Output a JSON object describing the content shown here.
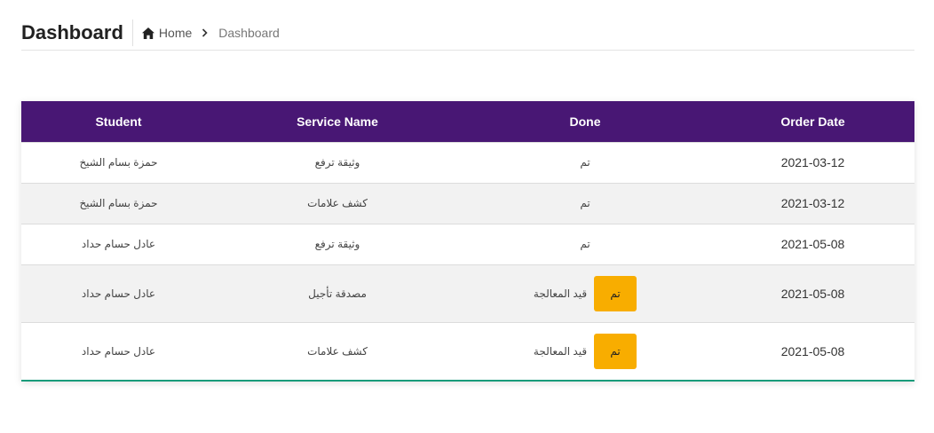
{
  "header": {
    "title": "Dashboard",
    "breadcrumb": {
      "home": "Home",
      "current": "Dashboard"
    }
  },
  "table": {
    "columns": [
      "Student",
      "Service Name",
      "Done",
      "Order Date"
    ],
    "rows": [
      {
        "student": "حمزة بسام الشيخ",
        "service": "وثيقة ترفع",
        "done": "تم",
        "date": "2021-03-12"
      },
      {
        "student": "حمزة بسام الشيخ",
        "service": "كشف علامات",
        "done": "تم",
        "date": "2021-03-12"
      },
      {
        "student": "عادل حسام حداد",
        "service": "وثيقة ترفع",
        "done": "تم",
        "date": "2021-05-08"
      },
      {
        "student": "عادل حسام حداد",
        "service": "مصدقة تأجيل",
        "done": "قيد المعالجة",
        "button": "تم",
        "date": "2021-05-08"
      },
      {
        "student": "عادل حسام حداد",
        "service": "كشف علامات",
        "done": "قيد المعالجة",
        "button": "تم",
        "date": "2021-05-08"
      }
    ]
  },
  "colors": {
    "header_bg": "#481774",
    "action_button": "#f8ad00",
    "table_bottom_border": "#169b7a"
  },
  "icons": {
    "home": "home-icon",
    "separator": "chevron-right-icon"
  }
}
